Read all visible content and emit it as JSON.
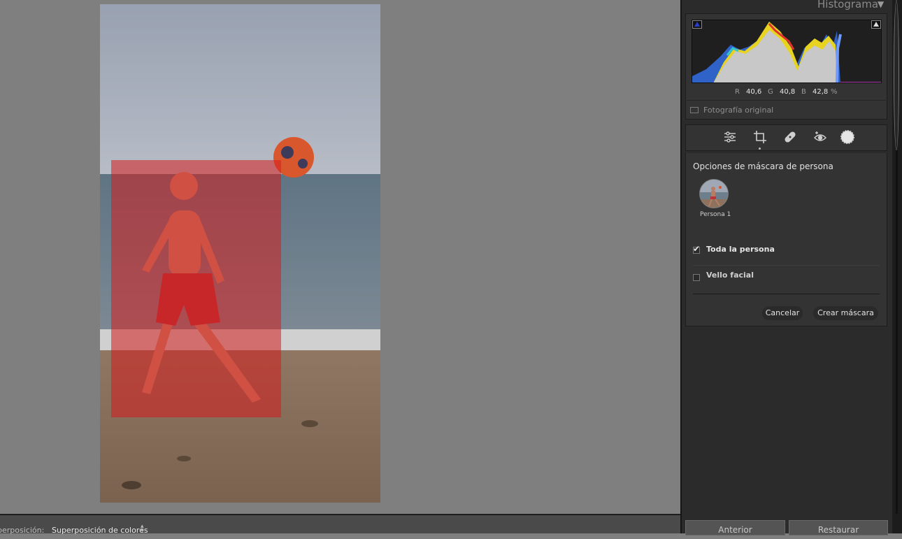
{
  "panel": {
    "histogram_title": "Histograma",
    "rgb": {
      "r_key": "R",
      "r_val": "40,6",
      "g_key": "G",
      "g_val": "40,8",
      "b_key": "B",
      "b_val": "42,8",
      "unit": "%"
    },
    "original_photo_label": "Fotografía original"
  },
  "tools": [
    "sliders-icon",
    "crop-icon",
    "healing-icon",
    "redeye-icon",
    "masking-icon"
  ],
  "mask": {
    "title": "Opciones de máscara de persona",
    "person_label": "Persona 1",
    "options": [
      {
        "label": "Toda la persona",
        "checked": true
      },
      {
        "label": "Vello facial",
        "checked": false
      }
    ],
    "cancel_label": "Cancelar",
    "create_label": "Crear máscara"
  },
  "bottombar": {
    "overlay_label": "perposición:",
    "overlay_value": "Superposición de colores"
  },
  "footer": {
    "previous_label": "Anterior",
    "reset_label": "Restaurar"
  },
  "colors": {
    "mask_overlay": "#d61e1e",
    "panel_bg": "#2b2b2b",
    "canvas_bg": "#7f7f7f"
  }
}
